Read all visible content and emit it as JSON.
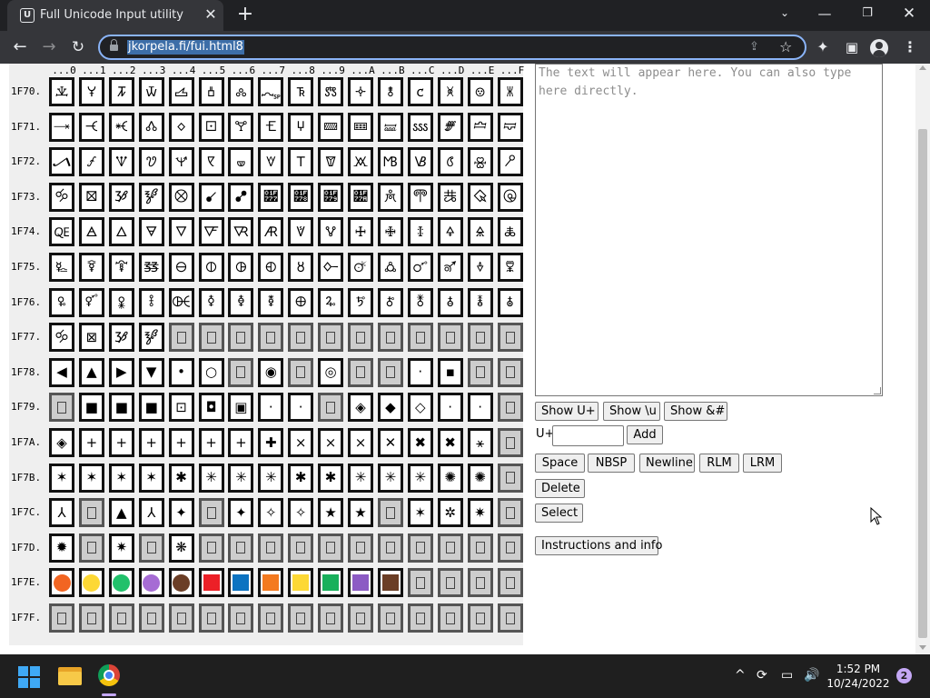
{
  "browser": {
    "tab_title": "Full Unicode Input utility",
    "favicon_glyph": "U",
    "tab_close": "✕",
    "new_tab": "+",
    "tab_search": "⌄",
    "win_min": "—",
    "win_max": "❐",
    "win_close": "✕",
    "back": "←",
    "forward": "→",
    "reload": "↻",
    "url": "jkorpela.fi/fui.html8",
    "share": "⇪",
    "star": "☆",
    "extensions": "✦",
    "side_panel": "▣",
    "menu": "⋮"
  },
  "grid": {
    "col_headers": [
      "...0",
      "...1",
      "...2",
      "...3",
      "...4",
      "...5",
      "...6",
      "...7",
      "...8",
      "...9",
      "...A",
      "...B",
      "...C",
      "...D",
      "...E",
      "...F"
    ],
    "rows": [
      {
        "label": "1F70.",
        "cells": [
          "🝀",
          "🝁",
          "🝂",
          "🝃",
          "🝄",
          "🝅",
          "🝆",
          "🝇",
          "🝈",
          "🝉",
          "🝊",
          "🝋",
          "🝌",
          "🝍",
          "🝎",
          "🝏"
        ]
      },
      {
        "label": "1F71.",
        "cells": [
          "🝐",
          "🝑",
          "🝒",
          "🝓",
          "🝔",
          "🝕",
          "🝖",
          "🝗",
          "🝘",
          "🝙",
          "🝚",
          "🝛",
          "🝜",
          "🝝",
          "🝞",
          "🝟"
        ]
      },
      {
        "label": "1F72.",
        "cells": [
          "🝠",
          "🝡",
          "🝢",
          "🝣",
          "🝤",
          "🝥",
          "🝦",
          "🝧",
          "🝨",
          "🝩",
          "🝪",
          "🝫",
          "🝬",
          "🝭",
          "🝮",
          "🝯"
        ]
      },
      {
        "label": "1F73.",
        "cells": [
          "🝰",
          "🝱",
          "🝲",
          "🝳",
          "🝴",
          "🝵",
          "🝶",
          "🝷",
          "🝸",
          "🝹",
          "🝺",
          "🝻",
          "🝼",
          "🝽",
          "🝾",
          "🝿"
        ]
      },
      {
        "label": "1F74.",
        "cells": [
          "🜀",
          "🜁",
          "🜂",
          "🜃",
          "🜄",
          "🜅",
          "🜆",
          "🜇",
          "🜈",
          "🜉",
          "🜊",
          "🜋",
          "🜌",
          "🜍",
          "🜎",
          "🜏"
        ]
      },
      {
        "label": "1F75.",
        "cells": [
          "🜐",
          "🜑",
          "🜒",
          "🜓",
          "🜔",
          "🜕",
          "🜖",
          "🜗",
          "🜘",
          "🜙",
          "🜚",
          "🜛",
          "🜜",
          "🜝",
          "🜞",
          "🜟"
        ]
      },
      {
        "label": "1F76.",
        "cells": [
          "🜠",
          "🜡",
          "🜢",
          "🜣",
          "🜤",
          "🜥",
          "🜦",
          "🜧",
          "🜨",
          "🜩",
          "🜪",
          "🜫",
          "🜬",
          "🜭",
          "🜮",
          "🜯"
        ]
      },
      {
        "label": "1F77.",
        "cells": [
          "🝰",
          "⊠",
          "🝲",
          "🝳",
          "",
          "",
          "",
          "",
          "",
          "",
          "",
          "",
          "",
          "",
          "",
          ""
        ]
      },
      {
        "label": "1F78.",
        "cells": [
          "◀",
          "▲",
          "▶",
          "▼",
          "•",
          "○",
          "",
          "◉",
          "",
          "◎",
          "",
          "",
          "·",
          "▪",
          "",
          ""
        ]
      },
      {
        "label": "1F79.",
        "cells": [
          "",
          "■",
          "■",
          "■",
          "⊡",
          "◘",
          "▣",
          "·",
          "·",
          "",
          "◈",
          "◆",
          "◇",
          "·",
          "·",
          ""
        ]
      },
      {
        "label": "1F7A.",
        "cells": [
          "◈",
          "+",
          "+",
          "+",
          "+",
          "+",
          "+",
          "✚",
          "×",
          "×",
          "×",
          "✕",
          "✖",
          "✖",
          "⚹",
          ""
        ]
      },
      {
        "label": "1F7B.",
        "cells": [
          "✶",
          "✶",
          "✶",
          "✶",
          "✱",
          "✳",
          "✳",
          "✳",
          "✱",
          "✱",
          "✳",
          "✳",
          "✳",
          "✺",
          "✺",
          ""
        ]
      },
      {
        "label": "1F7C.",
        "cells": [
          "⅄",
          "",
          "▲",
          "⅄",
          "✦",
          "",
          "✦",
          "✧",
          "✧",
          "★",
          "★",
          "",
          "✶",
          "✲",
          "✷",
          ""
        ]
      },
      {
        "label": "1F7D.",
        "cells": [
          "✹",
          "",
          "✷",
          "",
          "❋",
          "",
          "",
          "",
          "",
          "",
          "",
          "",
          "",
          "",
          "",
          ""
        ]
      },
      {
        "label": "1F7E.",
        "cells": [
          "circle:#f26522",
          "circle:#fdd835",
          "circle:#21c16b",
          "circle:#a66cd4",
          "circle:#6b3e26",
          "square:#ec2027",
          "square:#0d73c1",
          "square:#f47a20",
          "square:#fdd835",
          "square:#19b05c",
          "square:#8c5bc4",
          "square:#6b3e26",
          "",
          "",
          "",
          ""
        ]
      },
      {
        "label": "1F7F.",
        "cells": [
          "",
          "",
          "",
          "",
          "",
          "",
          "",
          "",
          "",
          "",
          "",
          "",
          "",
          "",
          "",
          ""
        ]
      }
    ]
  },
  "text_area": {
    "placeholder": "The text will appear here. You can also type here directly."
  },
  "controls": {
    "show_uplus": "Show U+",
    "show_u": "Show \\u",
    "show_amp": "Show &#",
    "uplus_label": "U+",
    "uplus_value": "",
    "add": "Add",
    "space": "Space",
    "nbsp": "NBSP",
    "newline": "Newline",
    "rlm": "RLM",
    "lrm": "LRM",
    "delete": "Delete",
    "select": "Select",
    "instructions": "Instructions and info"
  },
  "taskbar": {
    "tray_chevron": "^",
    "tray_sync": "⟳",
    "tray_network": "▭",
    "tray_volume": "🔊",
    "time": "1:52 PM",
    "date": "10/24/2022",
    "notification_count": "2"
  }
}
